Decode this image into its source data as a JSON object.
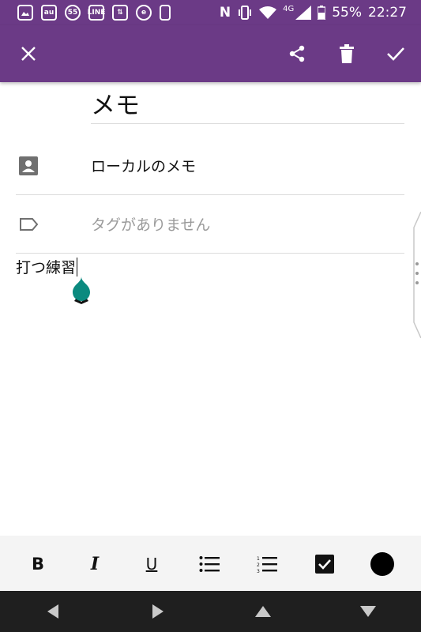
{
  "status_bar": {
    "battery": "55%",
    "time": "22:27",
    "network": "4G",
    "notification_icons": [
      "gallery-icon",
      "au-icon",
      "55",
      "line-icon",
      "transfer-icon",
      "e",
      "phone-icon"
    ]
  },
  "app_bar": {
    "actions": [
      "close-icon",
      "share-icon",
      "delete-icon",
      "check-icon"
    ]
  },
  "note": {
    "title": "メモ",
    "account": "ローカルのメモ",
    "tags_placeholder": "タグがありません",
    "body": "打つ練習"
  },
  "format_toolbar": {
    "items": [
      "bold-icon",
      "italic-icon",
      "underline-icon",
      "bulleted-list-icon",
      "numbered-list-icon",
      "checkbox-icon",
      "color-circle-icon"
    ]
  },
  "colors": {
    "header": "#6b3a86",
    "handle": "#0b8a7f",
    "toolbar_bg": "#f4f4f4",
    "navbar": "#1f1f1f"
  }
}
